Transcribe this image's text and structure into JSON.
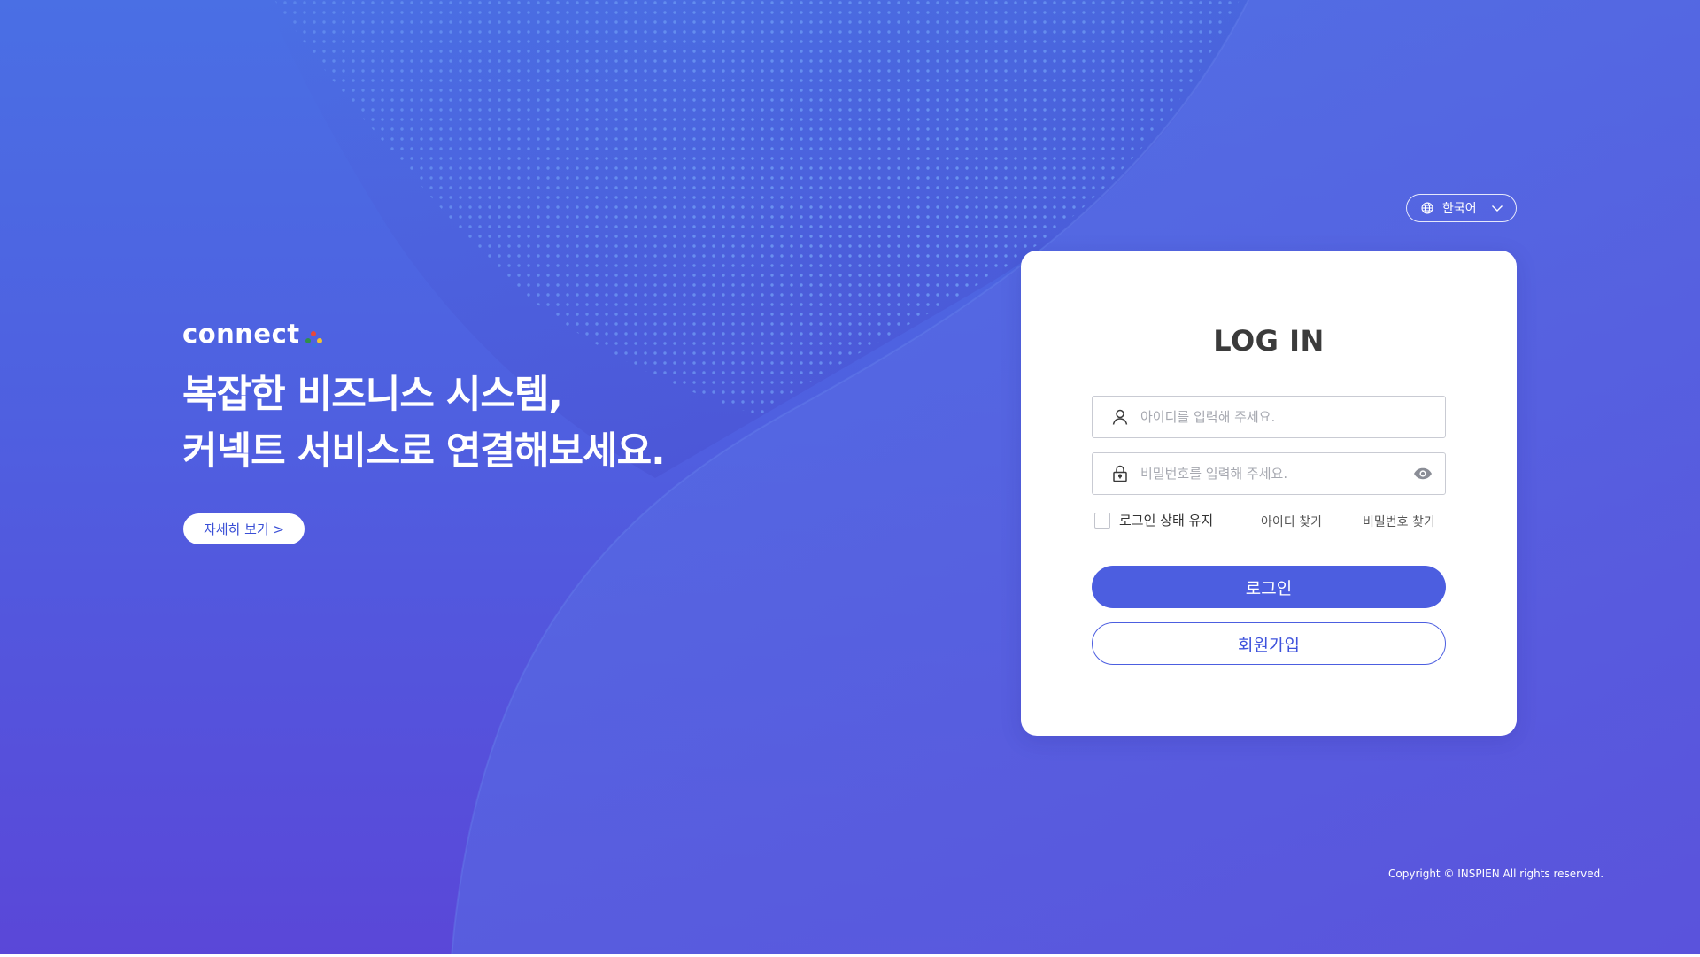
{
  "brand": {
    "logo_text": "connect",
    "dot_colors": [
      "#e8473a",
      "#2f8f4a",
      "#3b6fe0",
      "#f2c230"
    ]
  },
  "hero": {
    "line1": "복잡한 비즈니스 시스템,",
    "line2": "커넥트 서비스로 연결해보세요.",
    "more_button": "자세히 보기 >"
  },
  "language": {
    "selected": "한국어",
    "icon": "globe-icon"
  },
  "login": {
    "title": "LOG IN",
    "id_placeholder": "아이디를 입력해 주세요.",
    "id_value": "",
    "password_placeholder": "비밀번호를 입력해 주세요.",
    "password_value": "",
    "keep_logged_in": "로그인 상태 유지",
    "keep_logged_in_checked": false,
    "find_id": "아이디 찾기",
    "find_password": "비밀번호 찾기",
    "login_button": "로그인",
    "signup_button": "회원가입"
  },
  "footer": {
    "copyright": "Copyright © INSPIEN All rights reserved."
  },
  "colors": {
    "background_top": "#4a6fe4",
    "background_bottom": "#5a47d8",
    "accent": "#4c5ee0"
  }
}
